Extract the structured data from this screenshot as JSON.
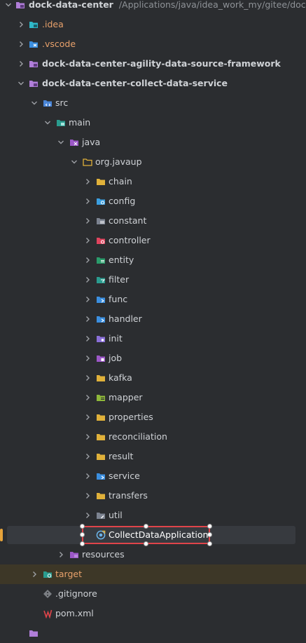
{
  "colors": {
    "background": "#2b2d30",
    "folder_yellow": "#e0b13a",
    "module_purple": "#b07ed8",
    "excluded_bg": "#3d3727",
    "excluded_text": "#e8a16b",
    "selection_border": "#e0444a"
  },
  "tree": {
    "root": {
      "label": "dock-data-center",
      "path": "/Applications/java/idea_work_my/gitee/dock-d"
    },
    "idea": {
      "label": ".idea"
    },
    "vscode": {
      "label": ".vscode"
    },
    "framework_module": {
      "label": "dock-data-center-agility-data-source-framework"
    },
    "collect_module": {
      "label": "dock-data-center-collect-data-service"
    },
    "src": {
      "label": "src"
    },
    "main": {
      "label": "main"
    },
    "java": {
      "label": "java"
    },
    "package": {
      "label": "org.javaup"
    },
    "packages": [
      {
        "label": "chain",
        "icon": "folder-icon"
      },
      {
        "label": "config",
        "icon": "config-folder-icon"
      },
      {
        "label": "constant",
        "icon": "constant-folder-icon"
      },
      {
        "label": "controller",
        "icon": "controller-folder-icon"
      },
      {
        "label": "entity",
        "icon": "entity-folder-icon"
      },
      {
        "label": "filter",
        "icon": "filter-folder-icon"
      },
      {
        "label": "func",
        "icon": "interface-folder-icon"
      },
      {
        "label": "handler",
        "icon": "interface-folder-icon"
      },
      {
        "label": "init",
        "icon": "init-folder-icon"
      },
      {
        "label": "job",
        "icon": "job-folder-icon"
      },
      {
        "label": "kafka",
        "icon": "folder-icon"
      },
      {
        "label": "mapper",
        "icon": "mapper-folder-icon"
      },
      {
        "label": "properties",
        "icon": "folder-icon"
      },
      {
        "label": "reconciliation",
        "icon": "folder-icon"
      },
      {
        "label": "result",
        "icon": "folder-icon"
      },
      {
        "label": "service",
        "icon": "service-folder-icon"
      },
      {
        "label": "transfers",
        "icon": "folder-icon"
      },
      {
        "label": "util",
        "icon": "util-folder-icon"
      }
    ],
    "application_class": {
      "label": "CollectDataApplication"
    },
    "resources": {
      "label": "resources"
    },
    "target": {
      "label": "target"
    },
    "gitignore": {
      "label": ".gitignore"
    },
    "pom": {
      "label": "pom.xml"
    }
  }
}
